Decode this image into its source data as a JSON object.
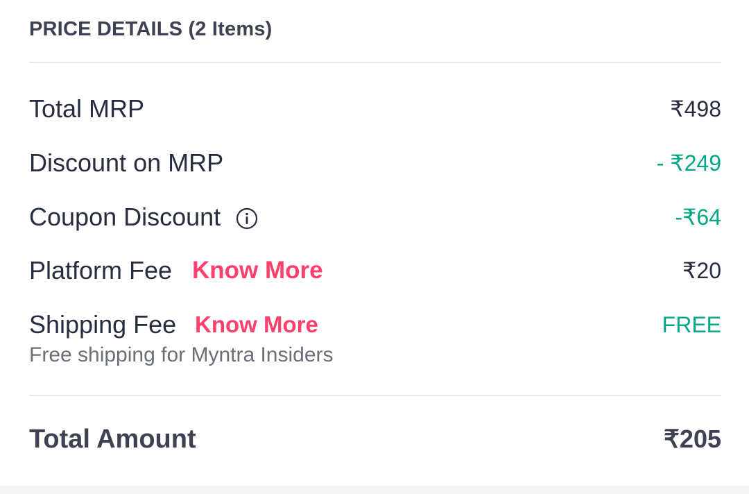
{
  "price_details": {
    "header": "PRICE DETAILS (2 Items)",
    "rows": [
      {
        "label": "Total MRP",
        "value": "₹498"
      },
      {
        "label": "Discount on MRP",
        "value": "- ₹249"
      },
      {
        "label": "Coupon Discount",
        "value": "-₹64"
      },
      {
        "label": "Platform Fee",
        "link": "Know More",
        "value": "₹20"
      },
      {
        "label": "Shipping Fee",
        "link": "Know More",
        "value": "FREE",
        "subtext": "Free shipping for Myntra Insiders"
      }
    ],
    "total": {
      "label": "Total Amount",
      "value": "₹205"
    }
  },
  "colors": {
    "text": "#282c3f",
    "muted": "#696e79",
    "green": "#03a685",
    "pink": "#ff3f6c",
    "divider": "#eaeaec"
  },
  "icons": {
    "coupon_info": "info-icon"
  }
}
